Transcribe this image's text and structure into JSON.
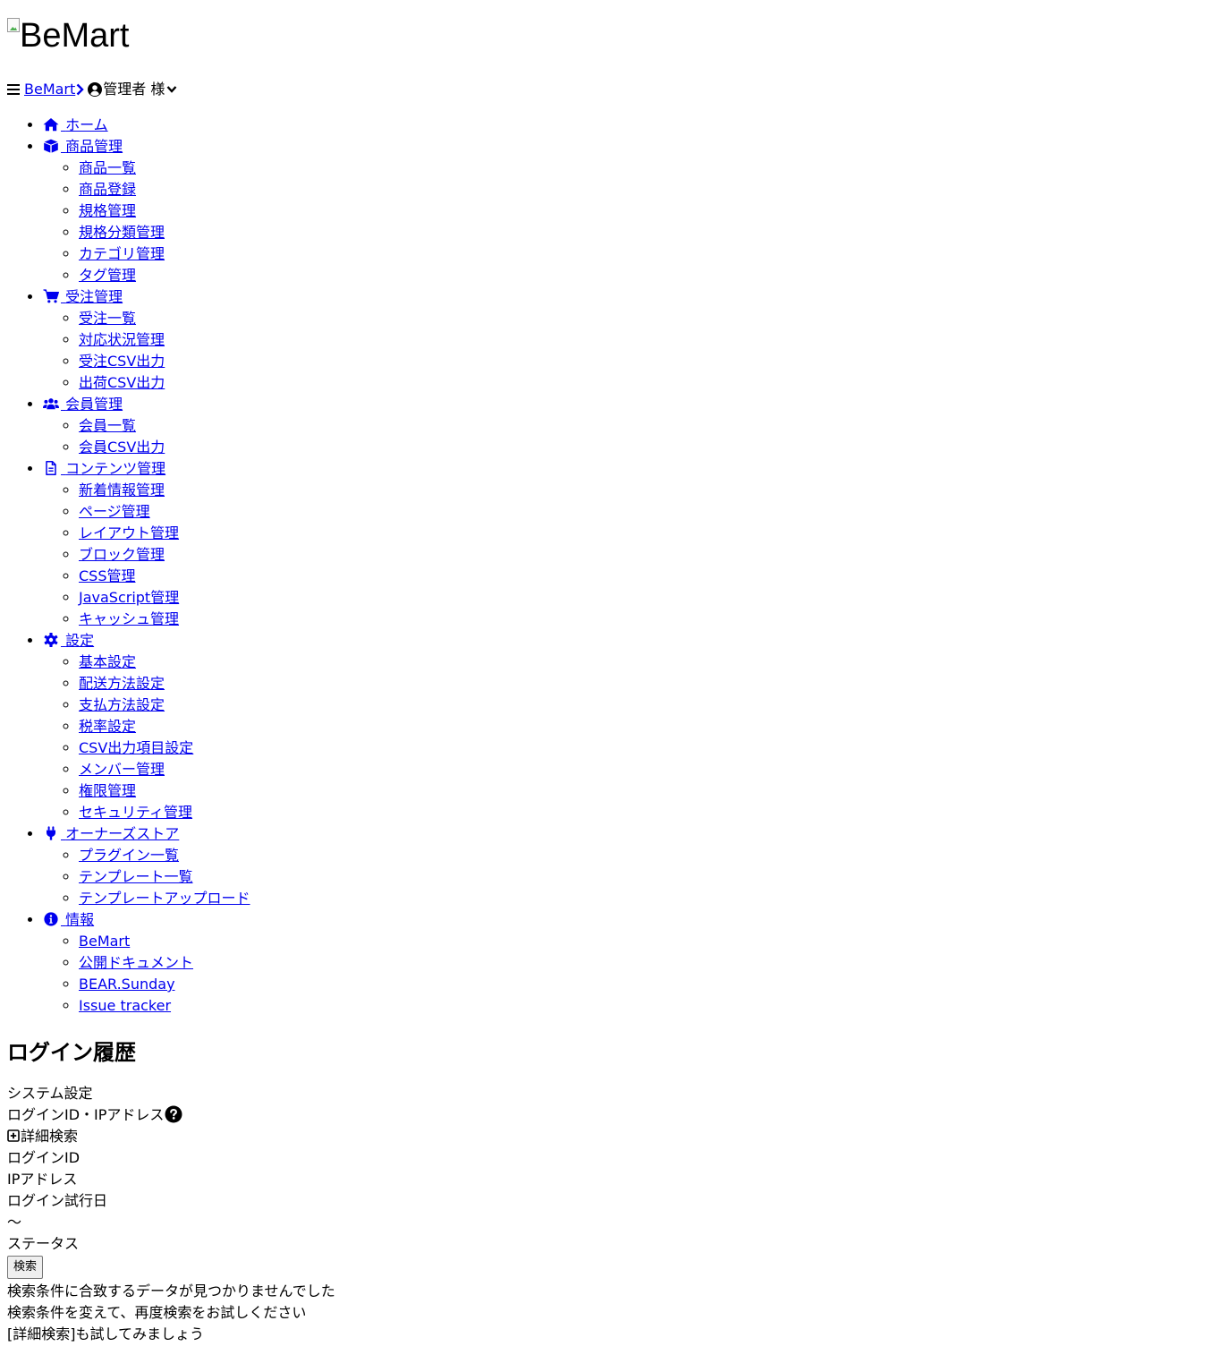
{
  "header": {
    "logo_alt": "BeMart",
    "breadcrumb_home": "BeMart",
    "user_label": "管理者 様"
  },
  "nav": [
    {
      "label": "ホーム",
      "icon": "home-icon",
      "children": []
    },
    {
      "label": "商品管理",
      "icon": "box-icon",
      "children": [
        "商品一覧",
        "商品登録",
        "規格管理",
        "規格分類管理",
        "カテゴリ管理",
        "タグ管理"
      ]
    },
    {
      "label": "受注管理",
      "icon": "cart-icon",
      "children": [
        "受注一覧",
        "対応状況管理",
        "受注CSV出力",
        "出荷CSV出力"
      ]
    },
    {
      "label": "会員管理",
      "icon": "users-icon",
      "children": [
        "会員一覧",
        "会員CSV出力"
      ]
    },
    {
      "label": "コンテンツ管理",
      "icon": "file-icon",
      "children": [
        "新着情報管理",
        "ページ管理",
        "レイアウト管理",
        "ブロック管理",
        "CSS管理",
        "JavaScript管理",
        "キャッシュ管理"
      ]
    },
    {
      "label": "設定",
      "icon": "gear-icon",
      "children": [
        "基本設定",
        "配送方法設定",
        "支払方法設定",
        "税率設定",
        "CSV出力項目設定",
        "メンバー管理",
        "権限管理",
        "セキュリティ管理"
      ]
    },
    {
      "label": "オーナーズストア",
      "icon": "plug-icon",
      "children": [
        "プラグイン一覧",
        "テンプレート一覧",
        "テンプレートアップロード"
      ]
    },
    {
      "label": "情報",
      "icon": "info-icon",
      "children": [
        "BeMart",
        "公開ドキュメント",
        "BEAR.Sunday",
        "Issue tracker"
      ]
    }
  ],
  "main": {
    "title": "ログイン履歴",
    "section_label": "システム設定",
    "search_label": "ログインID・IPアドレス",
    "advanced_toggle": "詳細検索",
    "field_login_id": "ログインID",
    "field_ip": "IPアドレス",
    "field_date": "ログイン試行日",
    "range_sep": "〜",
    "field_status": "ステータス",
    "search_button": "検索",
    "empty_1": "検索条件に合致するデータが見つかりませんでした",
    "empty_2": "検索条件を変えて、再度検索をお試しください",
    "empty_3": "[詳細検索]も試してみましょう"
  },
  "colors": {
    "link": "#0000ee",
    "text": "#000000",
    "background": "#ffffff"
  }
}
